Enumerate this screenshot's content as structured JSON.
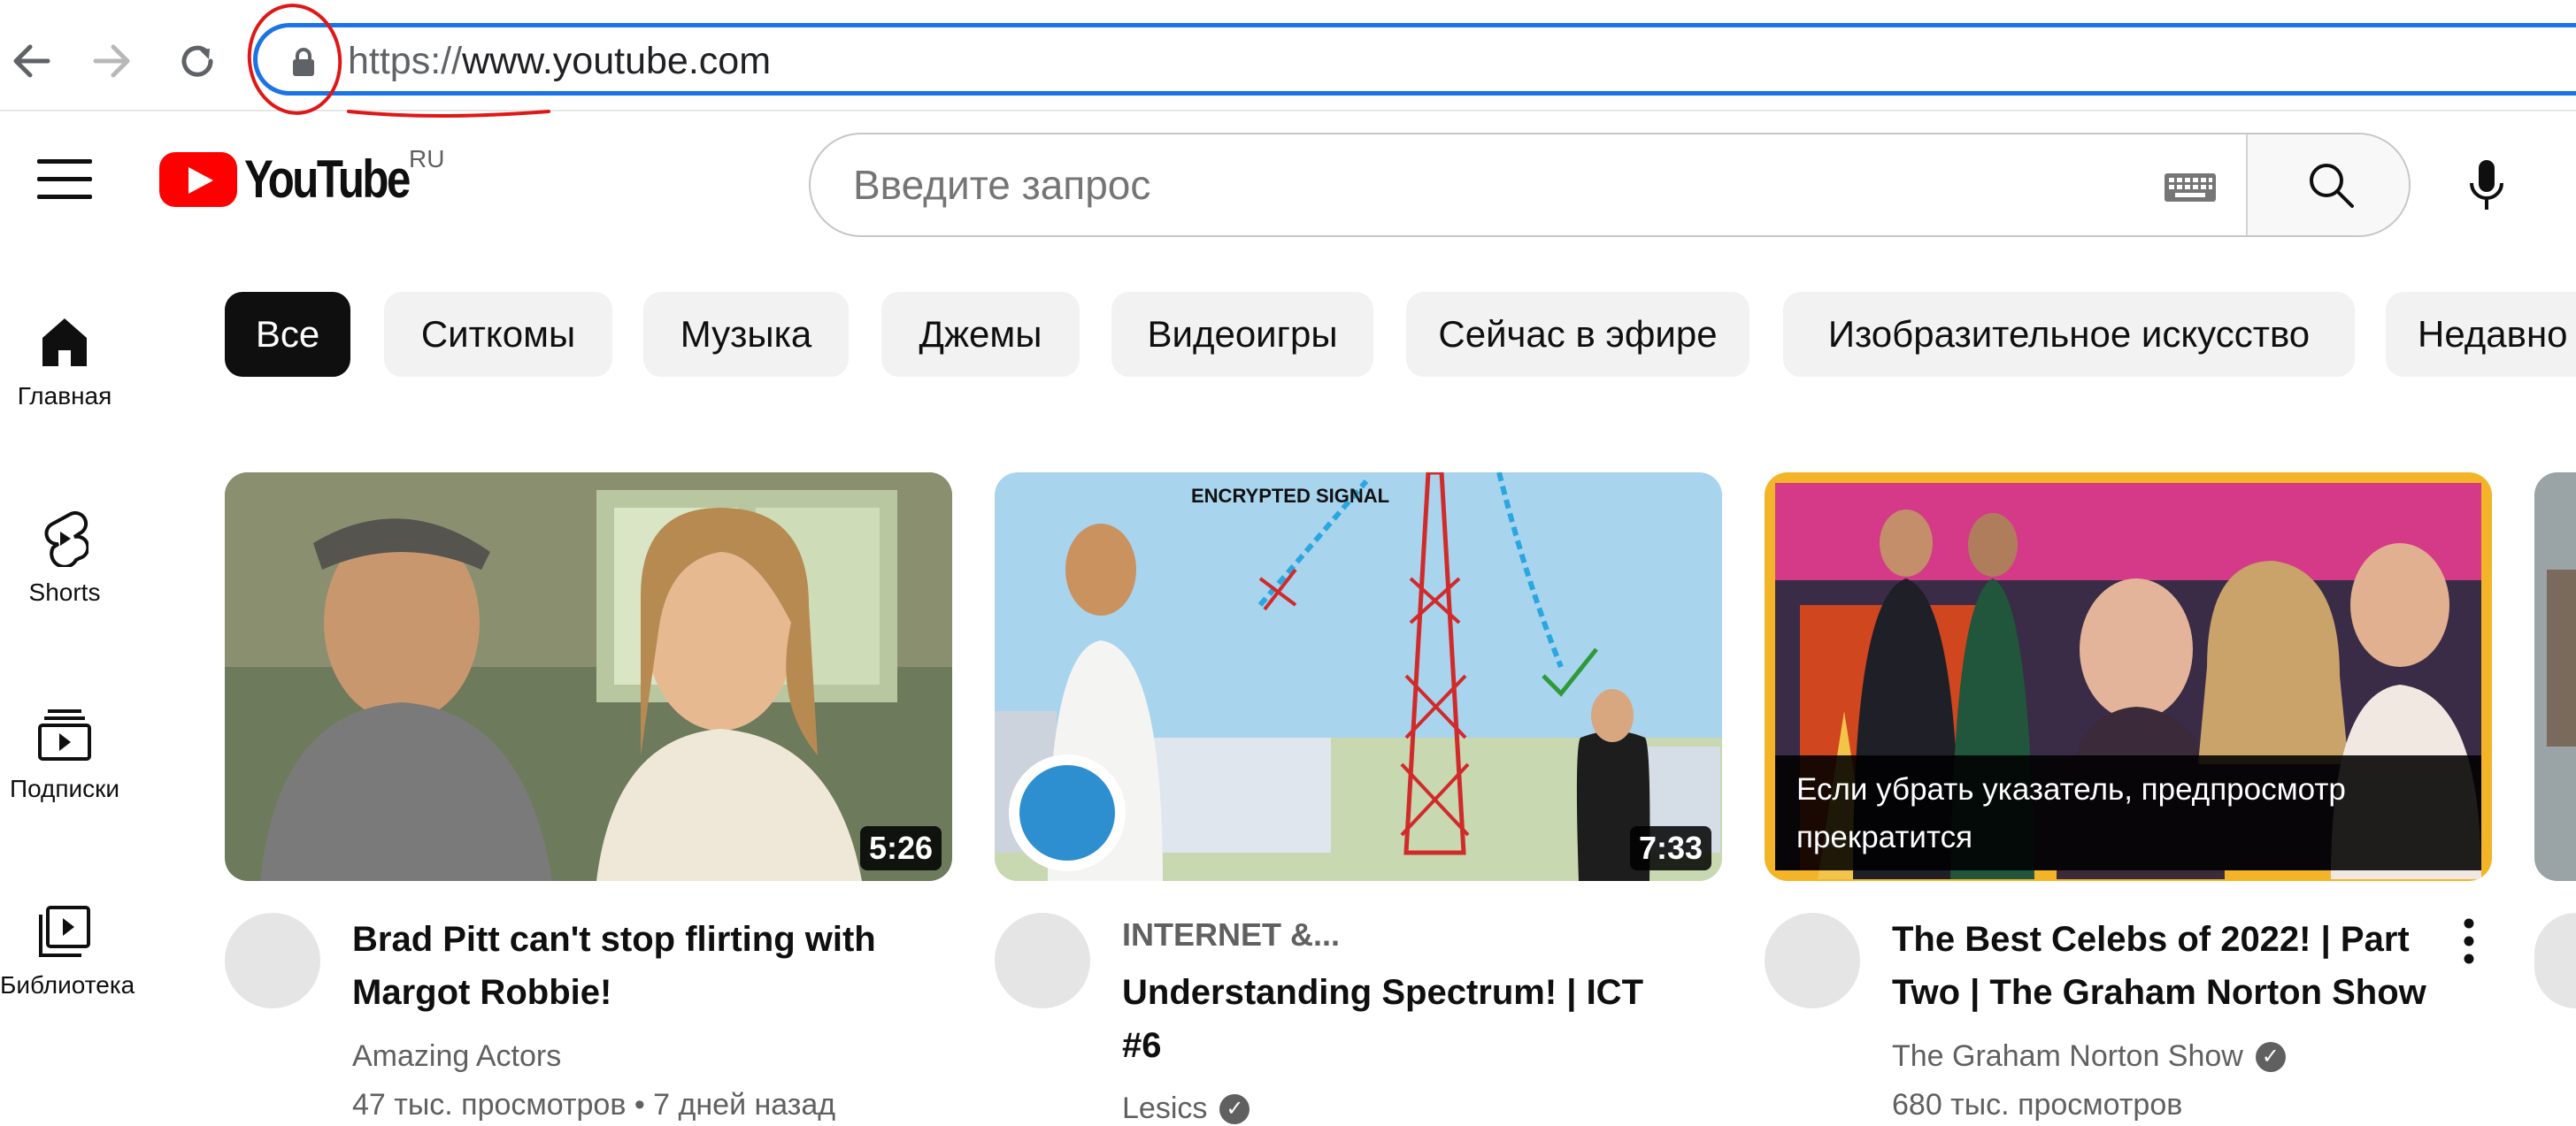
{
  "browser": {
    "url_scheme": "https://",
    "url_rest": "www.youtube.com"
  },
  "header": {
    "logo_text": "YouTube",
    "region": "RU",
    "search_placeholder": "Введите запрос"
  },
  "sidebar": {
    "items": [
      {
        "label": "Главная",
        "icon": "home-icon"
      },
      {
        "label": "Shorts",
        "icon": "shorts-icon"
      },
      {
        "label": "Подписки",
        "icon": "subscriptions-icon"
      },
      {
        "label": "Библиотека",
        "icon": "library-icon"
      }
    ]
  },
  "chips": [
    "Все",
    "Ситкомы",
    "Музыка",
    "Джемы",
    "Видеоигры",
    "Сейчас в эфире",
    "Изобразительное искусство",
    "Недавно"
  ],
  "videos": [
    {
      "title": "Brad Pitt can't stop flirting with Margot Robbie!",
      "channel": "Amazing Actors",
      "meta": "47 тыс. просмотров • 7 дней назад",
      "duration": "5:26"
    },
    {
      "chip_label": "INTERNET &...",
      "title": "Understanding Spectrum! | ICT #6",
      "channel": "Lesics",
      "duration": "7:33",
      "thumb_text": "ENCRYPTED SIGNAL"
    },
    {
      "title": "The Best Celebs of 2022! | Part Two | The Graham Norton Show",
      "channel": "The Graham Norton Show",
      "meta": "680 тыс. просмотров",
      "hover_note": "Если убрать указатель, предпросмотр прекратится"
    }
  ],
  "colors": {
    "accent": "#1a73e8",
    "brand": "#ff0000",
    "annotation": "#e01717"
  }
}
